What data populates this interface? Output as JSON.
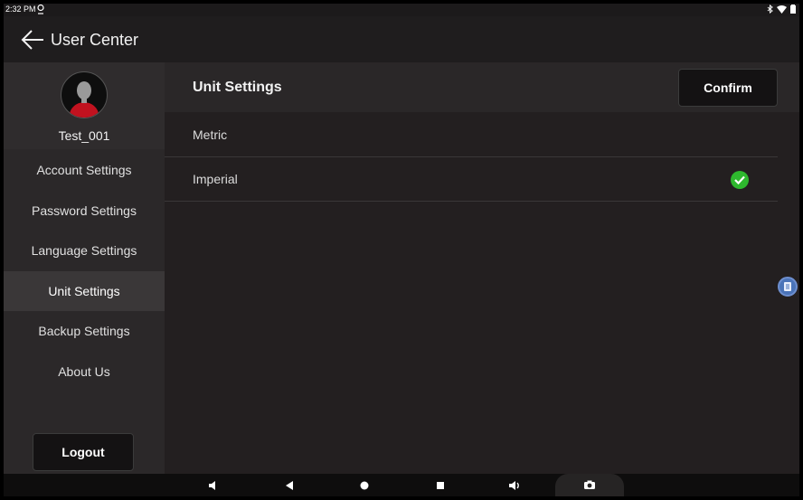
{
  "status_bar": {
    "time": "2:32 PM"
  },
  "app_bar": {
    "title": "User Center"
  },
  "sidebar": {
    "username": "Test_001",
    "items": [
      {
        "label": "Account Settings",
        "active": false
      },
      {
        "label": "Password Settings",
        "active": false
      },
      {
        "label": "Language Settings",
        "active": false
      },
      {
        "label": "Unit Settings",
        "active": true
      },
      {
        "label": "Backup Settings",
        "active": false
      },
      {
        "label": "About Us",
        "active": false
      }
    ],
    "logout_label": "Logout"
  },
  "main": {
    "title": "Unit Settings",
    "confirm_label": "Confirm",
    "options": [
      {
        "label": "Metric",
        "selected": false
      },
      {
        "label": "Imperial",
        "selected": true
      }
    ]
  },
  "icons": [
    "back-arrow-icon",
    "location-icon",
    "bluetooth-icon",
    "wifi-icon",
    "battery-icon",
    "avatar-icon",
    "check-icon",
    "floating-app-icon",
    "volume-down-icon",
    "back-icon",
    "home-icon",
    "recents-icon",
    "volume-up-icon",
    "camera-icon"
  ],
  "colors": {
    "accent_check": "#2eb82e",
    "background": "#231f20"
  }
}
